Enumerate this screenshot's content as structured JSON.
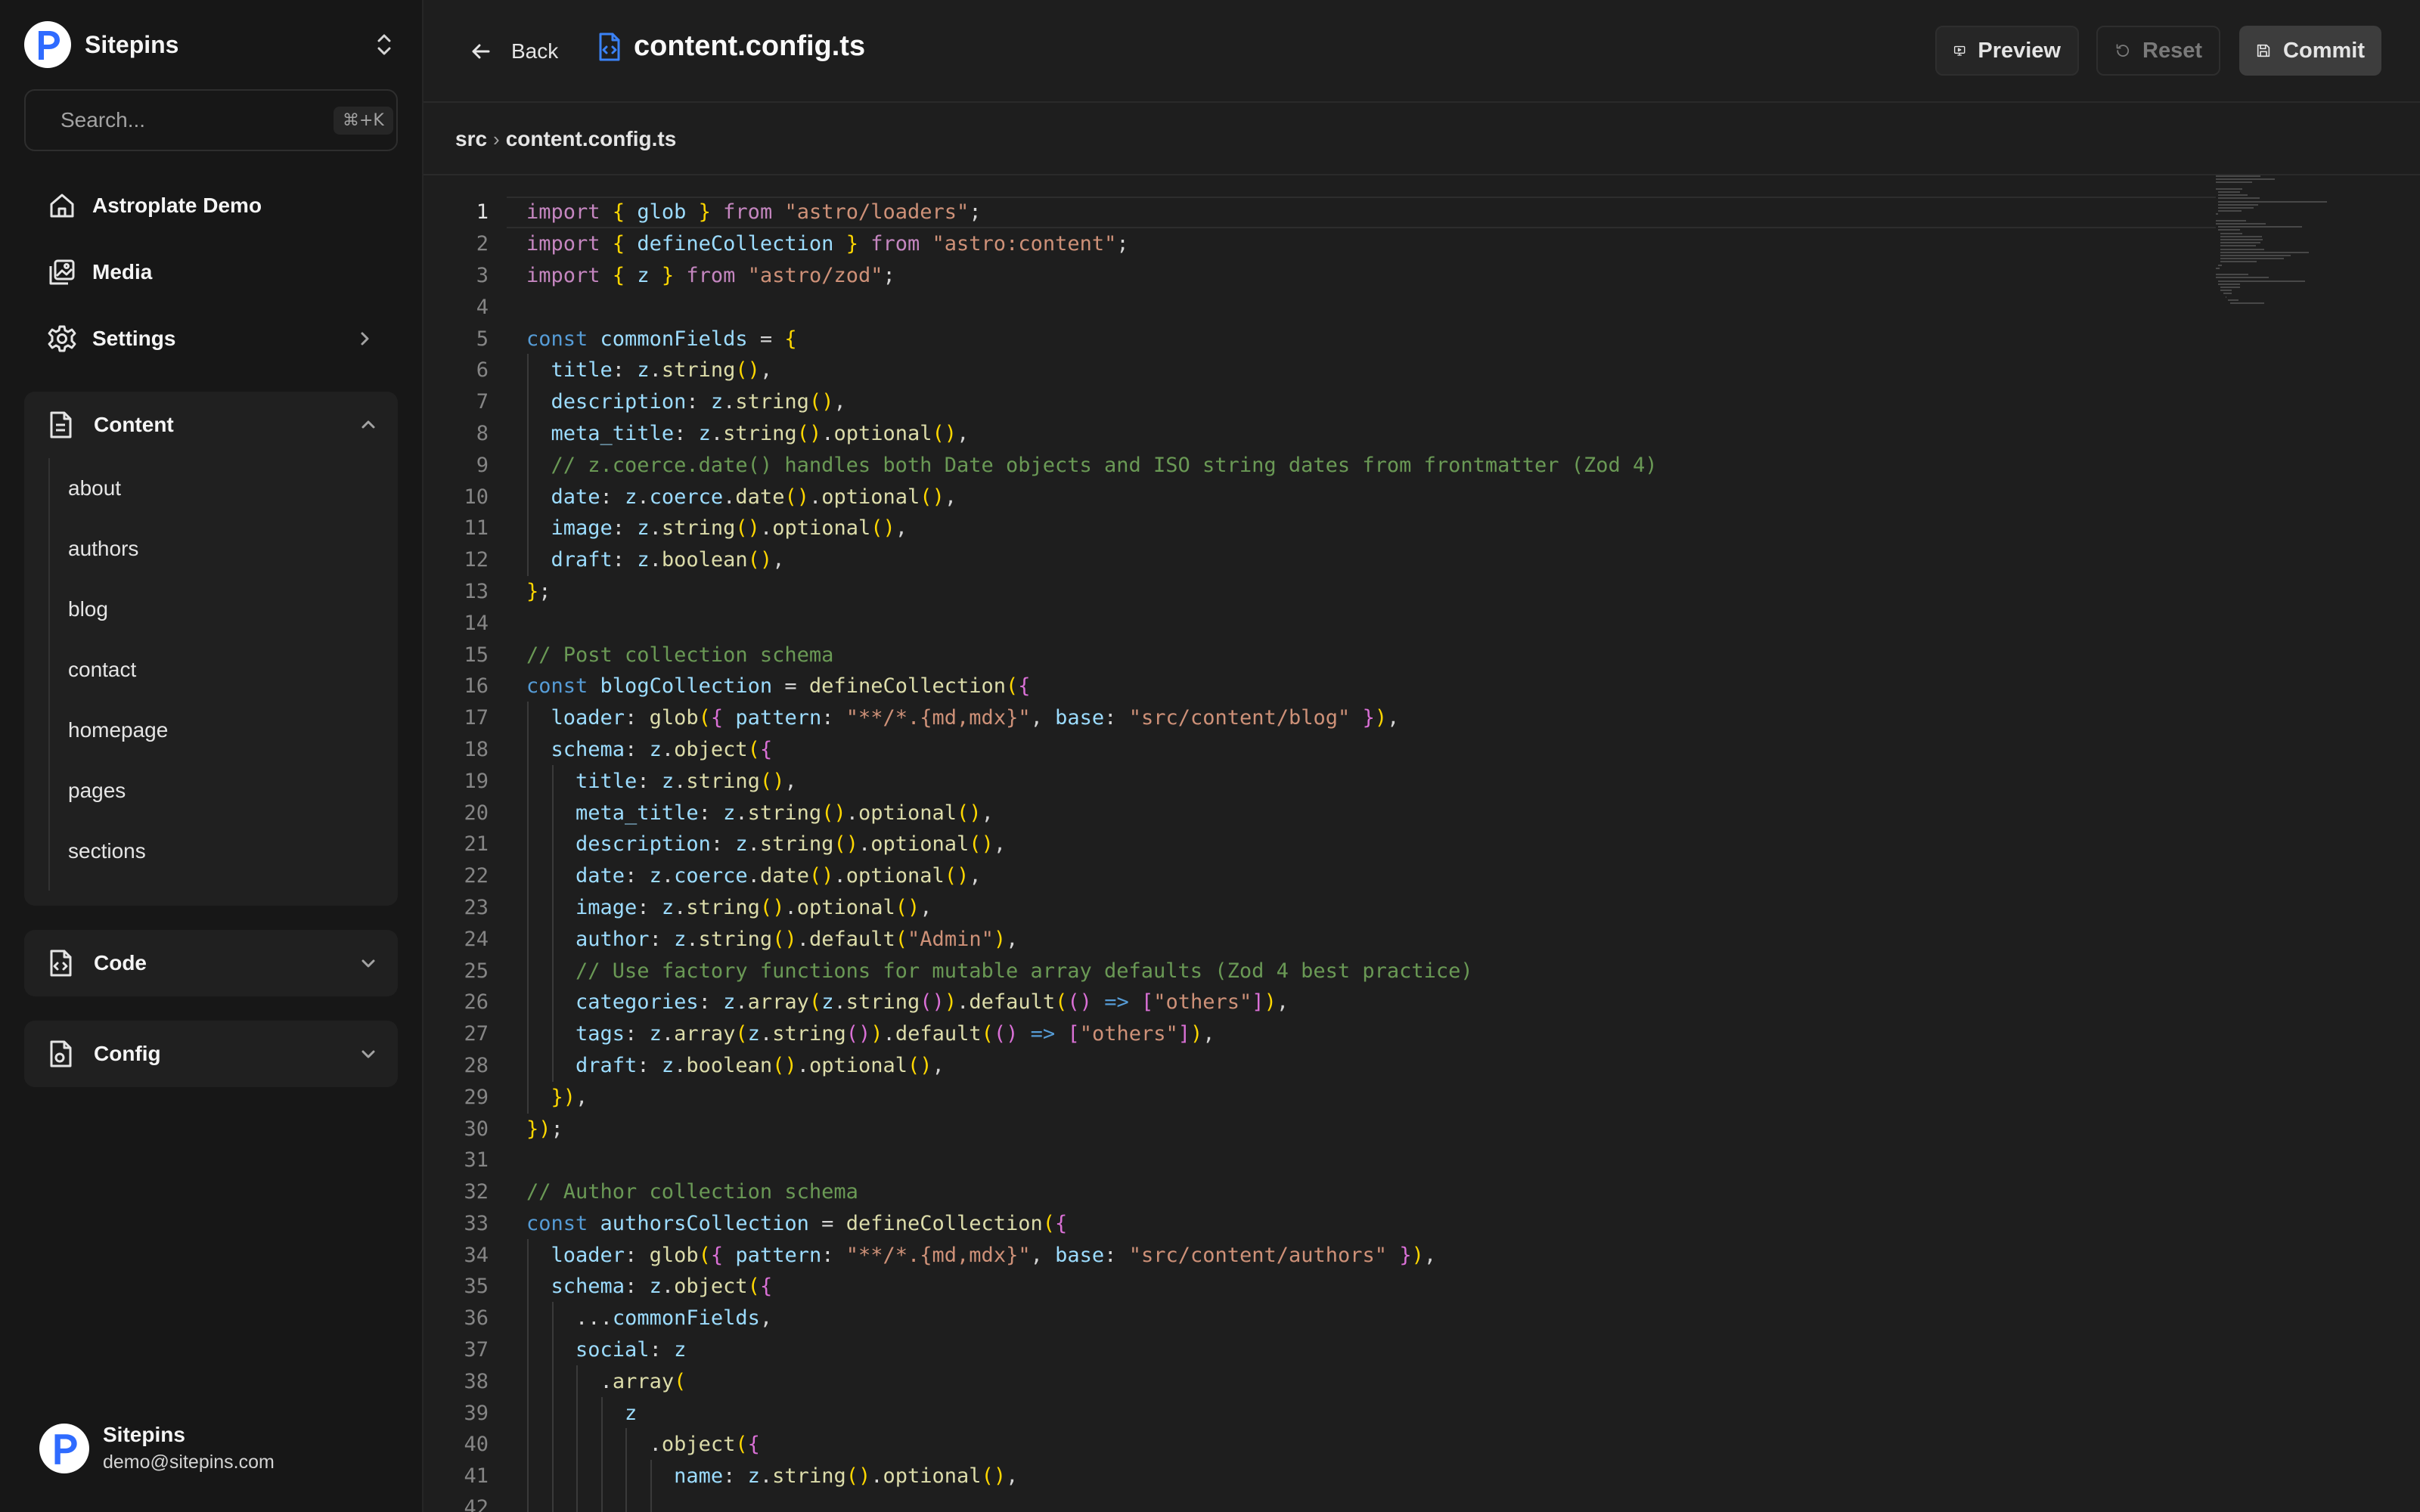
{
  "app": {
    "name": "Sitepins"
  },
  "search": {
    "placeholder": "Search...",
    "shortcut": "⌘+K"
  },
  "nav": {
    "site": "Astroplate Demo",
    "media": "Media",
    "settings": "Settings"
  },
  "content_group": {
    "label": "Content",
    "items": [
      "about",
      "authors",
      "blog",
      "contact",
      "homepage",
      "pages",
      "sections"
    ]
  },
  "code_group": {
    "label": "Code"
  },
  "config_group": {
    "label": "Config"
  },
  "user": {
    "name": "Sitepins",
    "email": "demo@sitepins.com"
  },
  "toolbar": {
    "back": "Back",
    "file_name": "content.config.ts",
    "preview": "Preview",
    "reset": "Reset",
    "commit": "Commit"
  },
  "breadcrumb": {
    "folder": "src",
    "file": "content.config.ts"
  },
  "editor": {
    "current_line": 1,
    "lines": [
      "import { glob } from \"astro/loaders\";",
      "import { defineCollection } from \"astro:content\";",
      "import { z } from \"astro/zod\";",
      "",
      "const commonFields = {",
      "  title: z.string(),",
      "  description: z.string(),",
      "  meta_title: z.string().optional(),",
      "  // z.coerce.date() handles both Date objects and ISO string dates from frontmatter (Zod 4)",
      "  date: z.coerce.date().optional(),",
      "  image: z.string().optional(),",
      "  draft: z.boolean(),",
      "};",
      "",
      "// Post collection schema",
      "const blogCollection = defineCollection({",
      "  loader: glob({ pattern: \"**/*.{md,mdx}\", base: \"src/content/blog\" }),",
      "  schema: z.object({",
      "    title: z.string(),",
      "    meta_title: z.string().optional(),",
      "    description: z.string().optional(),",
      "    date: z.coerce.date().optional(),",
      "    image: z.string().optional(),",
      "    author: z.string().default(\"Admin\"),",
      "    // Use factory functions for mutable array defaults (Zod 4 best practice)",
      "    categories: z.array(z.string()).default(() => [\"others\"]),",
      "    tags: z.array(z.string()).default(() => [\"others\"]),",
      "    draft: z.boolean().optional(),",
      "  }),",
      "});",
      "",
      "// Author collection schema",
      "const authorsCollection = defineCollection({",
      "  loader: glob({ pattern: \"**/*.{md,mdx}\", base: \"src/content/authors\" }),",
      "  schema: z.object({",
      "    ...commonFields,",
      "    social: z",
      "      .array(",
      "        z",
      "          .object({",
      "            name: z.string().optional(),",
      "            "
    ]
  }
}
